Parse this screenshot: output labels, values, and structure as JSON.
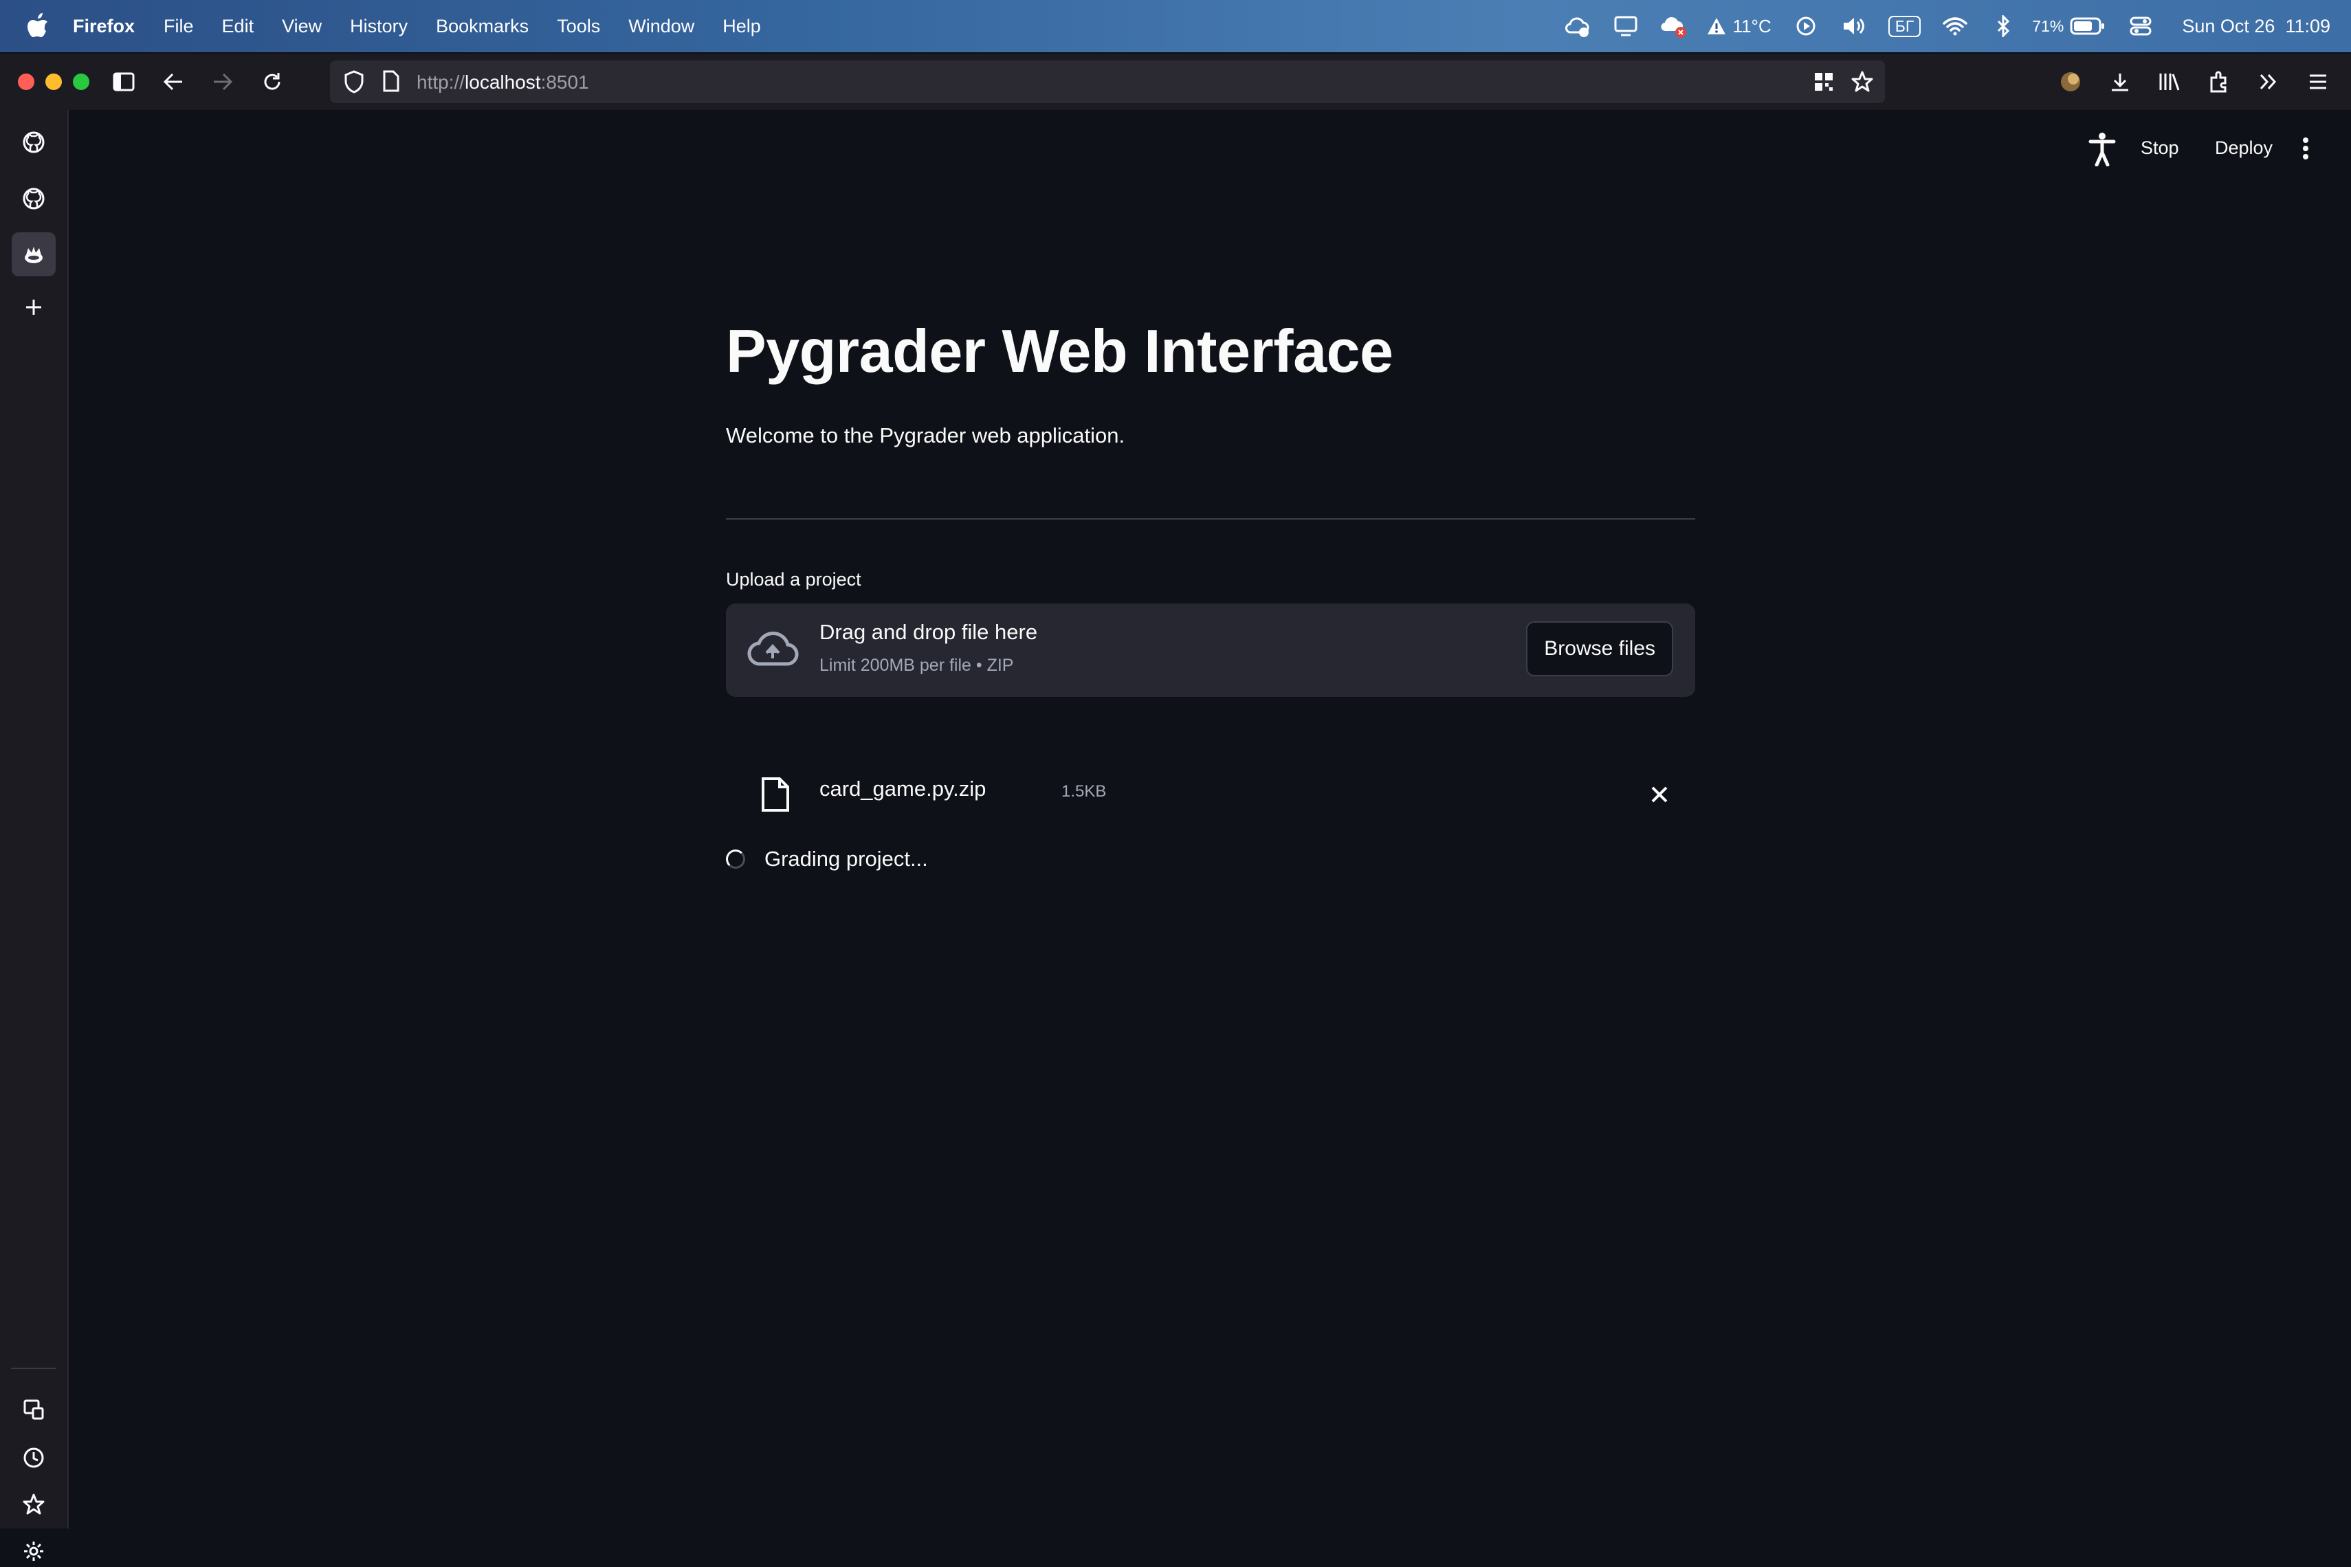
{
  "menubar": {
    "app_name": "Firefox",
    "items": [
      "File",
      "Edit",
      "View",
      "History",
      "Bookmarks",
      "Tools",
      "Window",
      "Help"
    ],
    "weather": "11°C",
    "keyboard_layout": "БГ",
    "battery": "71%",
    "clock": "Sun Oct 26  11:09"
  },
  "browser": {
    "url_scheme": "http://",
    "url_host": "localhost",
    "url_port": ":8501"
  },
  "app_header": {
    "stop_label": "Stop",
    "deploy_label": "Deploy"
  },
  "main": {
    "title": "Pygrader Web Interface",
    "subtitle": "Welcome to the Pygrader web application.",
    "upload_label": "Upload a project",
    "dropzone_title": "Drag and drop file here",
    "dropzone_subtitle": "Limit 200MB per file • ZIP",
    "browse_label": "Browse files",
    "file_name": "card_game.py.zip",
    "file_size": "1.5KB",
    "status_text": "Grading project..."
  },
  "colors": {
    "background": "#0e1117",
    "dropzone": "#262730",
    "text": "#fafafa",
    "muted_text": "#a3a8b8"
  },
  "icons": {
    "sidebar": [
      "github-icon",
      "github-icon",
      "streamlit-crown-icon",
      "plus-icon",
      "synced-tabs-icon",
      "history-icon",
      "bookmarks-star-icon",
      "settings-gear-icon"
    ]
  }
}
